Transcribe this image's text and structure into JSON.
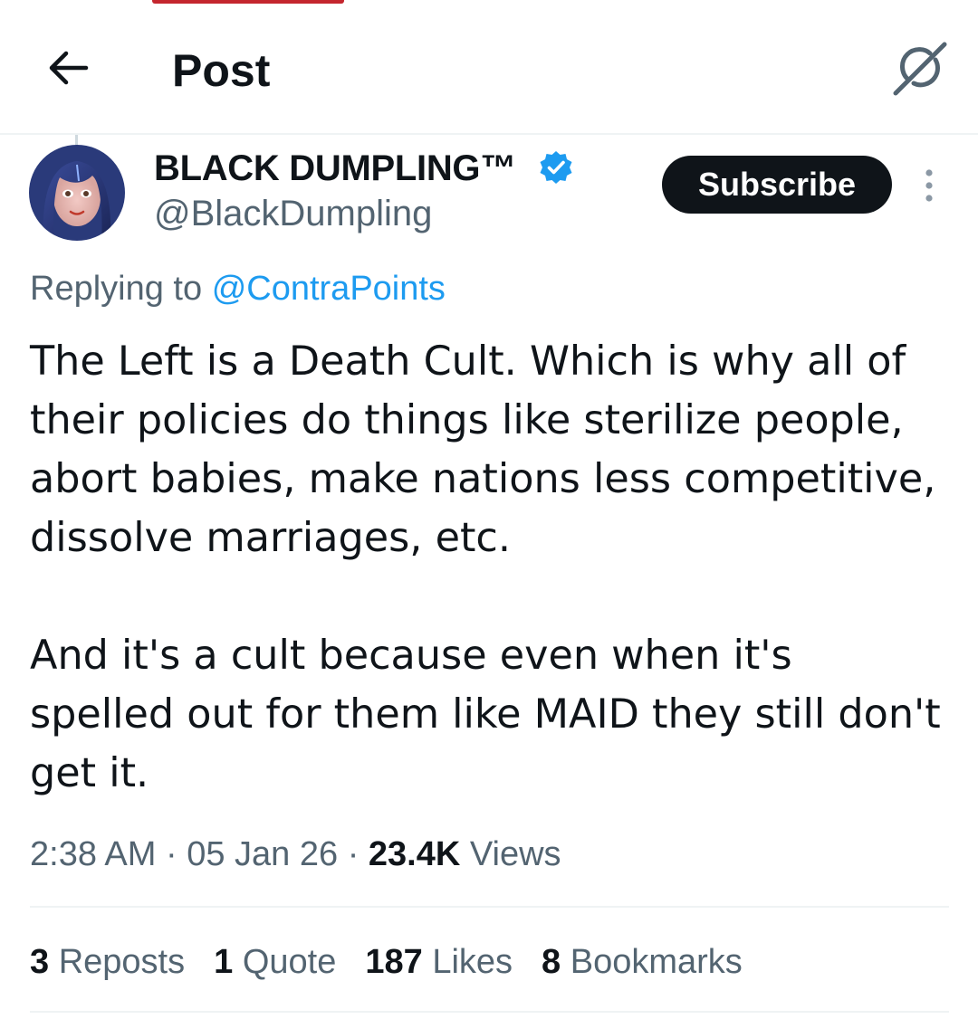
{
  "header": {
    "title": "Post",
    "back_icon": "arrow-left-icon",
    "grok_icon": "grok-icon"
  },
  "author": {
    "display_name": "BLACK DUMPLING™",
    "handle": "@BlackDumpling",
    "verified_icon": "verified-badge-icon",
    "verified_color": "#1d9bf0"
  },
  "actions": {
    "subscribe_label": "Subscribe",
    "more_icon": "more-vertical-icon"
  },
  "reply": {
    "prefix": "Replying to",
    "mention": "@ContraPoints"
  },
  "tweet": {
    "paragraphs": [
      "The Left is a Death Cult. Which is why all of their policies do things like sterilize people, abort babies, make nations less competitive, dissolve marriages, etc.",
      "And it's a cult because even when it's spelled out for them like MAID they still don't get it."
    ]
  },
  "meta": {
    "time": "2:38 AM",
    "separator": "·",
    "date": "05 Jan 26",
    "views_count": "23.4K",
    "views_label": "Views"
  },
  "stats": [
    {
      "count": "3",
      "label": "Reposts"
    },
    {
      "count": "1",
      "label": "Quote"
    },
    {
      "count": "187",
      "label": "Likes"
    },
    {
      "count": "8",
      "label": "Bookmarks"
    }
  ],
  "colors": {
    "accent": "#1d9bf0",
    "text_primary": "#0f1419",
    "text_secondary": "#536471",
    "divider": "#eff3f4",
    "subscribe_bg": "#0f1419"
  }
}
